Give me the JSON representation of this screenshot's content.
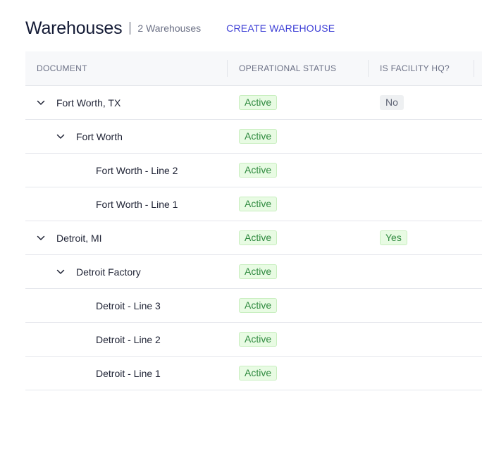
{
  "header": {
    "title": "Warehouses",
    "count": "2 Warehouses",
    "create_label": "CREATE WAREHOUSE"
  },
  "table": {
    "columns": [
      "DOCUMENT",
      "OPERATIONAL STATUS",
      "IS FACILITY HQ?"
    ],
    "rows": [
      {
        "name": "Fort Worth, TX",
        "level": 1,
        "expandable": true,
        "status": "Active",
        "hq": "No"
      },
      {
        "name": "Fort Worth",
        "level": 2,
        "expandable": true,
        "status": "Active",
        "hq": ""
      },
      {
        "name": "Fort Worth - Line 2",
        "level": 3,
        "expandable": false,
        "status": "Active",
        "hq": ""
      },
      {
        "name": "Fort Worth - Line 1",
        "level": 3,
        "expandable": false,
        "status": "Active",
        "hq": ""
      },
      {
        "name": "Detroit, MI",
        "level": 1,
        "expandable": true,
        "status": "Active",
        "hq": "Yes"
      },
      {
        "name": "Detroit Factory",
        "level": 2,
        "expandable": true,
        "status": "Active",
        "hq": ""
      },
      {
        "name": "Detroit - Line 3",
        "level": 3,
        "expandable": false,
        "status": "Active",
        "hq": ""
      },
      {
        "name": "Detroit - Line 2",
        "level": 3,
        "expandable": false,
        "status": "Active",
        "hq": ""
      },
      {
        "name": "Detroit - Line 1",
        "level": 3,
        "expandable": false,
        "status": "Active",
        "hq": ""
      }
    ]
  },
  "icons": {
    "expand": "chevron-down-icon"
  },
  "colors": {
    "accent": "#3d3fd6",
    "active_bg": "#e8fbe3",
    "active_text": "#2f8a3f",
    "neutral_bg": "#eef0f2"
  }
}
